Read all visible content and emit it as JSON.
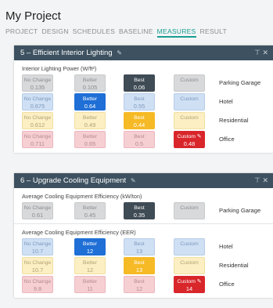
{
  "project_title": "My Project",
  "tabs": [
    {
      "label": "PROJECT",
      "active": false
    },
    {
      "label": "DESIGN",
      "active": false
    },
    {
      "label": "SCHEDULES",
      "active": false
    },
    {
      "label": "BASELINE",
      "active": false
    },
    {
      "label": "MEASURES",
      "active": true
    },
    {
      "label": "RESULT",
      "active": false
    }
  ],
  "colors": {
    "header": "#3d5160",
    "active_tab": "#1a9d94",
    "best_selected": "#3f4b55",
    "hotel": "#1f6fd6",
    "residential": "#f6ba26",
    "office": "#d8262b"
  },
  "measure5": {
    "title": "5 – Efficient Interior Lighting",
    "icons": [
      "pencil-icon",
      "filter-icon",
      "close-icon"
    ],
    "section_label": "Interior Lighting Power (W/ft²)",
    "rows": [
      {
        "label": "Parking Garage",
        "selected": 2,
        "color": "gray",
        "cells": [
          {
            "t": "No Change",
            "v": "0.135"
          },
          {
            "t": "Better",
            "v": "0.105"
          },
          {
            "t": "Best",
            "v": "0.06"
          },
          {
            "t": "Custom",
            "v": ""
          }
        ]
      },
      {
        "label": "Hotel",
        "selected": 1,
        "color": "blue",
        "cells": [
          {
            "t": "No Change",
            "v": "0.675"
          },
          {
            "t": "Better",
            "v": "0.64"
          },
          {
            "t": "Best",
            "v": "0.55"
          },
          {
            "t": "Custom",
            "v": ""
          }
        ]
      },
      {
        "label": "Residential",
        "selected": 2,
        "color": "yellow",
        "cells": [
          {
            "t": "No Change",
            "v": "0.612"
          },
          {
            "t": "Better",
            "v": "0.49"
          },
          {
            "t": "Best",
            "v": "0.44"
          },
          {
            "t": "Custom",
            "v": ""
          }
        ]
      },
      {
        "label": "Office",
        "selected": 3,
        "color": "red",
        "cells": [
          {
            "t": "No Change",
            "v": "0.711"
          },
          {
            "t": "Better",
            "v": "0.65"
          },
          {
            "t": "Best",
            "v": "0.5"
          },
          {
            "t": "Custom",
            "v": "0.48"
          }
        ]
      }
    ]
  },
  "measure6": {
    "title": "6 – Upgrade Cooling Equipment",
    "icons": [
      "pencil-icon",
      "filter-icon",
      "close-icon"
    ],
    "section1_label": "Average Cooling Equipment Efficiency (kW/ton)",
    "section1_rows": [
      {
        "label": "Parking Garage",
        "selected": 2,
        "color": "gray",
        "cells": [
          {
            "t": "No Change",
            "v": "0.61"
          },
          {
            "t": "Better",
            "v": "0.45"
          },
          {
            "t": "Best",
            "v": "0.35"
          },
          {
            "t": "Custom",
            "v": ""
          }
        ]
      }
    ],
    "section2_label": "Average Cooling Equipment Efficiency (EER)",
    "section2_rows": [
      {
        "label": "Hotel",
        "selected": 1,
        "color": "blue",
        "cells": [
          {
            "t": "No Change",
            "v": "10.7"
          },
          {
            "t": "Better",
            "v": "12"
          },
          {
            "t": "Best",
            "v": "13"
          },
          {
            "t": "Custom",
            "v": ""
          }
        ]
      },
      {
        "label": "Residential",
        "selected": 2,
        "color": "yellow",
        "cells": [
          {
            "t": "No Change",
            "v": "10.7"
          },
          {
            "t": "Better",
            "v": "12"
          },
          {
            "t": "Best",
            "v": "13"
          },
          {
            "t": "Custom",
            "v": ""
          }
        ]
      },
      {
        "label": "Office",
        "selected": 3,
        "color": "red",
        "cells": [
          {
            "t": "No Change",
            "v": "9.8"
          },
          {
            "t": "Better",
            "v": "11"
          },
          {
            "t": "Best",
            "v": "12"
          },
          {
            "t": "Custom",
            "v": "14"
          }
        ]
      }
    ]
  }
}
